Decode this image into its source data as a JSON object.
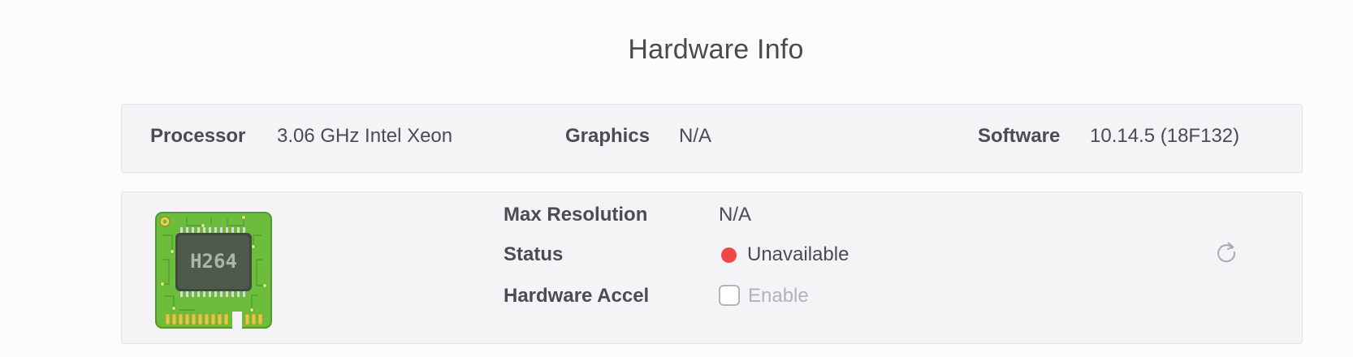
{
  "page": {
    "title": "Hardware Info"
  },
  "info": {
    "processor_label": "Processor",
    "processor_value": "3.06 GHz Intel Xeon",
    "graphics_label": "Graphics",
    "graphics_value": "N/A",
    "software_label": "Software",
    "software_value": "10.14.5 (18F132)"
  },
  "encoder": {
    "chip_icon": "h264-chip-icon",
    "chip_text": "H264",
    "max_resolution_label": "Max Resolution",
    "max_resolution_value": "N/A",
    "status_label": "Status",
    "status_value": "Unavailable",
    "status_color": "#f04848",
    "hardware_accel_label": "Hardware Accel",
    "enable_label": "Enable",
    "enable_checked": false,
    "refresh_icon": "refresh-icon"
  }
}
